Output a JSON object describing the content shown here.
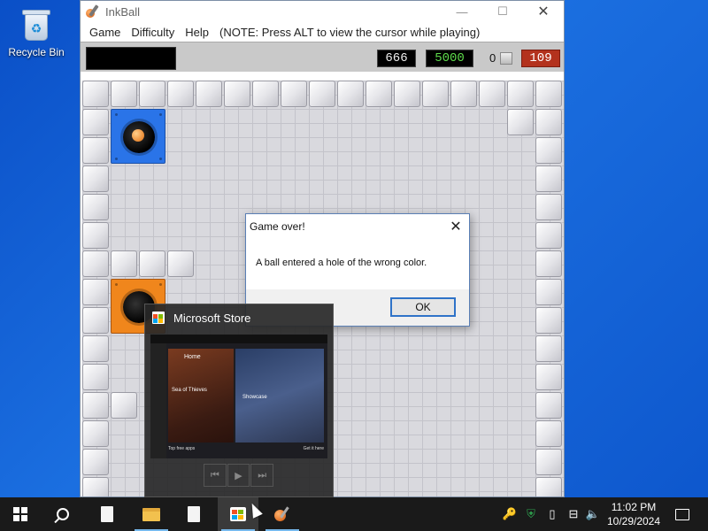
{
  "desktop": {
    "recycle_bin_label": "Recycle Bin"
  },
  "window": {
    "title": "InkBall",
    "minimize": "—",
    "maximize": "☐",
    "close": "✕"
  },
  "menu": {
    "items": [
      "Game",
      "Difficulty",
      "Help"
    ],
    "note": "(NOTE: Press ALT to view the cursor while playing)"
  },
  "scoreboard": {
    "score": "666",
    "target": "5000",
    "color_count": "0",
    "lives": "109"
  },
  "dialog": {
    "title": "Game over!",
    "message": "A ball entered a hole of the wrong color.",
    "ok_label": "OK",
    "close": "✕"
  },
  "thumbnail": {
    "title": "Microsoft Store",
    "home_label": "Home",
    "card1_text": "Sea of Thieves",
    "card2_text": "Showcase",
    "foot_left": "Top free apps",
    "foot_right": "Get it here"
  },
  "taskbar": {
    "time": "11:02 PM",
    "date": "10/29/2024"
  },
  "colors": {
    "desktop": "#0a4fc7",
    "hole_blue": "#2a74e8",
    "hole_orange": "#f0861c",
    "lives_bg": "#b3321d",
    "target_text": "#5fdc4c"
  }
}
